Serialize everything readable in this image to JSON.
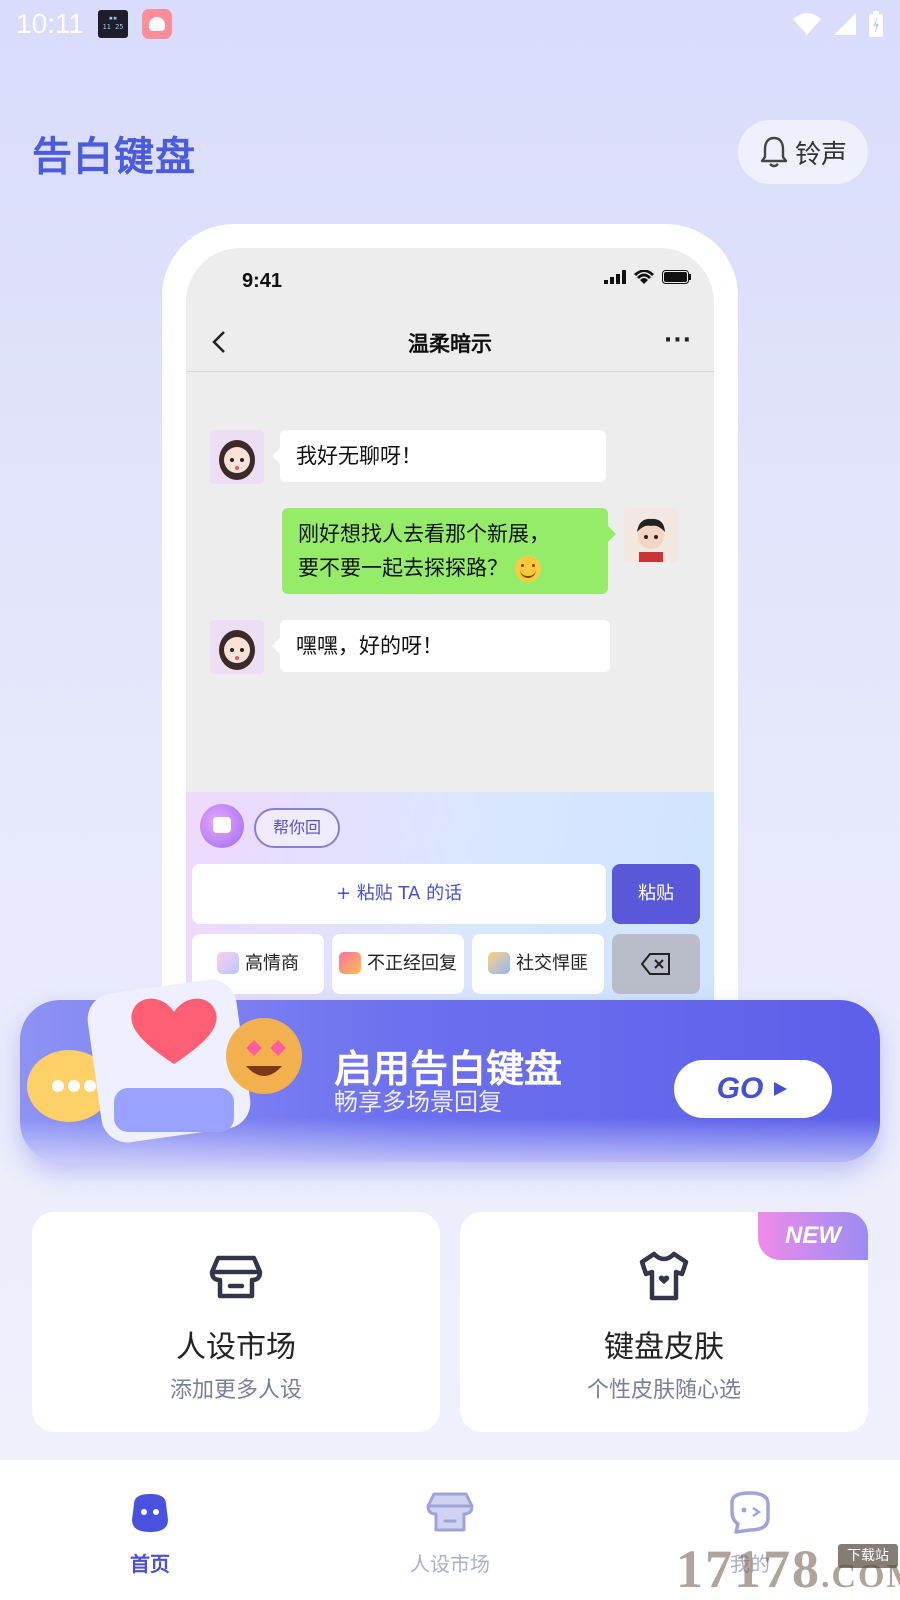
{
  "status_bar": {
    "time": "10:11"
  },
  "header": {
    "title": "告白键盘",
    "ringtone_label": "铃声"
  },
  "phone": {
    "time": "9:41",
    "chat_title": "温柔暗示",
    "messages": [
      {
        "side": "left",
        "text": "我好无聊呀！"
      },
      {
        "side": "right",
        "line1": "刚好想找人去看那个新展，",
        "line2": "要不要一起去探探路？"
      },
      {
        "side": "left",
        "text": "嘿嘿，好的呀！"
      }
    ],
    "keyboard": {
      "help_label": "帮你回",
      "paste_field": "+ 粘贴 TA 的话",
      "paste_button": "粘贴",
      "keys": [
        "高情商",
        "不正经回复",
        "社交悍匪"
      ]
    }
  },
  "banner": {
    "title": "启用告白键盘",
    "subtitle": "畅享多场景回复",
    "go_label": "GO"
  },
  "cards": [
    {
      "title": "人设市场",
      "subtitle": "添加更多人设"
    },
    {
      "title": "键盘皮肤",
      "subtitle": "个性皮肤随心选",
      "badge": "NEW"
    }
  ],
  "nav": {
    "items": [
      {
        "label": "首页"
      },
      {
        "label": "人设市场"
      },
      {
        "label": "我的"
      }
    ]
  },
  "watermark": {
    "text": "17178",
    "tag": "下载站",
    "suffix": ".COM"
  },
  "colors": {
    "accent": "#4b5be0",
    "banner": "#6c70ee",
    "bubble_green": "#95ec69"
  }
}
